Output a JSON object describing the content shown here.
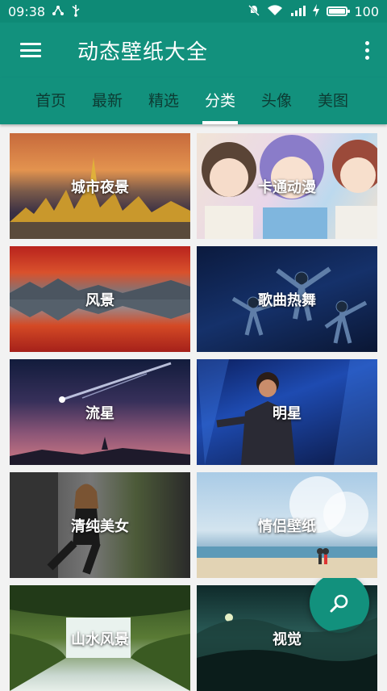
{
  "status": {
    "time": "09:38",
    "battery": "100",
    "battery_level": 1.0
  },
  "appbar": {
    "title": "动态壁纸大全"
  },
  "tabs": [
    {
      "label": "首页"
    },
    {
      "label": "最新"
    },
    {
      "label": "精选"
    },
    {
      "label": "分类",
      "active": true
    },
    {
      "label": "头像"
    },
    {
      "label": "美图"
    }
  ],
  "categories": [
    {
      "label": "城市夜景"
    },
    {
      "label": "卡通动漫"
    },
    {
      "label": "风景"
    },
    {
      "label": "歌曲热舞"
    },
    {
      "label": "流星"
    },
    {
      "label": "明星"
    },
    {
      "label": "清纯美女"
    },
    {
      "label": "情侣壁纸"
    },
    {
      "label": "山水风景"
    },
    {
      "label": "视觉"
    }
  ],
  "icons": {
    "menu": "hamburger-icon",
    "more": "more-vert-icon",
    "fab": "search-icon",
    "status": [
      "usb-icon",
      "notifications-off-icon",
      "wifi-icon",
      "signal-icon",
      "charging-icon",
      "battery-icon"
    ]
  },
  "colors": {
    "primary": "#12917d",
    "status_bar": "#0e8a76",
    "tab_inactive": "#0d3b33"
  }
}
